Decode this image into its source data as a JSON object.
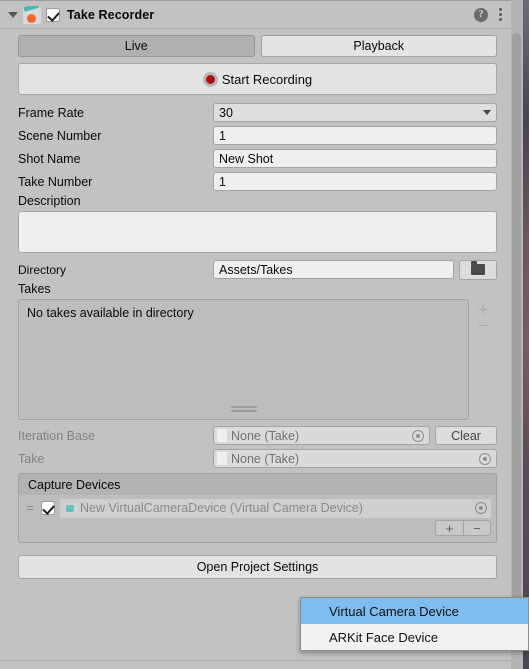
{
  "header": {
    "title": "Take Recorder",
    "foldout_icon": "triangle-down-icon",
    "component_icon": "take-recorder-icon",
    "enabled": true,
    "help_icon": "help-icon",
    "help_glyph": "?",
    "menu_icon": "kebab-menu-icon"
  },
  "tabs": [
    {
      "label": "Live",
      "active": true
    },
    {
      "label": "Playback",
      "active": false
    }
  ],
  "record": {
    "label": "Start Recording",
    "icon": "record-dot-icon",
    "dot_color": "#b40f0f"
  },
  "fields": {
    "frame_rate": {
      "label": "Frame Rate",
      "value": "30",
      "type": "popup"
    },
    "scene_number": {
      "label": "Scene Number",
      "value": "1",
      "type": "text"
    },
    "shot_name": {
      "label": "Shot Name",
      "value": "New Shot",
      "type": "text"
    },
    "take_number": {
      "label": "Take Number",
      "value": "1",
      "type": "text"
    },
    "description": {
      "label": "Description",
      "value": ""
    },
    "directory": {
      "label": "Directory",
      "value": "Assets/Takes",
      "browse_icon": "folder-icon"
    }
  },
  "takes": {
    "label": "Takes",
    "empty_message": "No takes available in directory",
    "add_label": "+",
    "remove_label": "−",
    "grip_icon": "resize-grip-icon"
  },
  "iteration": {
    "iteration_base": {
      "label": "Iteration Base",
      "value": "None (Take)",
      "clear_label": "Clear",
      "picker_icon": "object-picker-icon"
    },
    "take": {
      "label": "Take",
      "value": "None (Take)",
      "picker_icon": "object-picker-icon"
    }
  },
  "capture_devices": {
    "title": "Capture Devices",
    "rows": [
      {
        "handle_icon": "drag-handle-icon",
        "enabled": true,
        "device_icon": "virtual-camera-icon",
        "value": "New VirtualCameraDevice (Virtual Camera Device)",
        "picker_icon": "object-picker-icon"
      }
    ],
    "add_label": "+",
    "remove_label": "−"
  },
  "settings_button": {
    "label": "Open Project Settings"
  },
  "dropdown": {
    "items": [
      {
        "label": "Virtual Camera Device",
        "selected": true
      },
      {
        "label": "ARKit Face Device",
        "selected": false
      }
    ],
    "highlight_color": "#7fbdf0"
  },
  "scrollbar": {
    "name": "vertical-scrollbar"
  }
}
